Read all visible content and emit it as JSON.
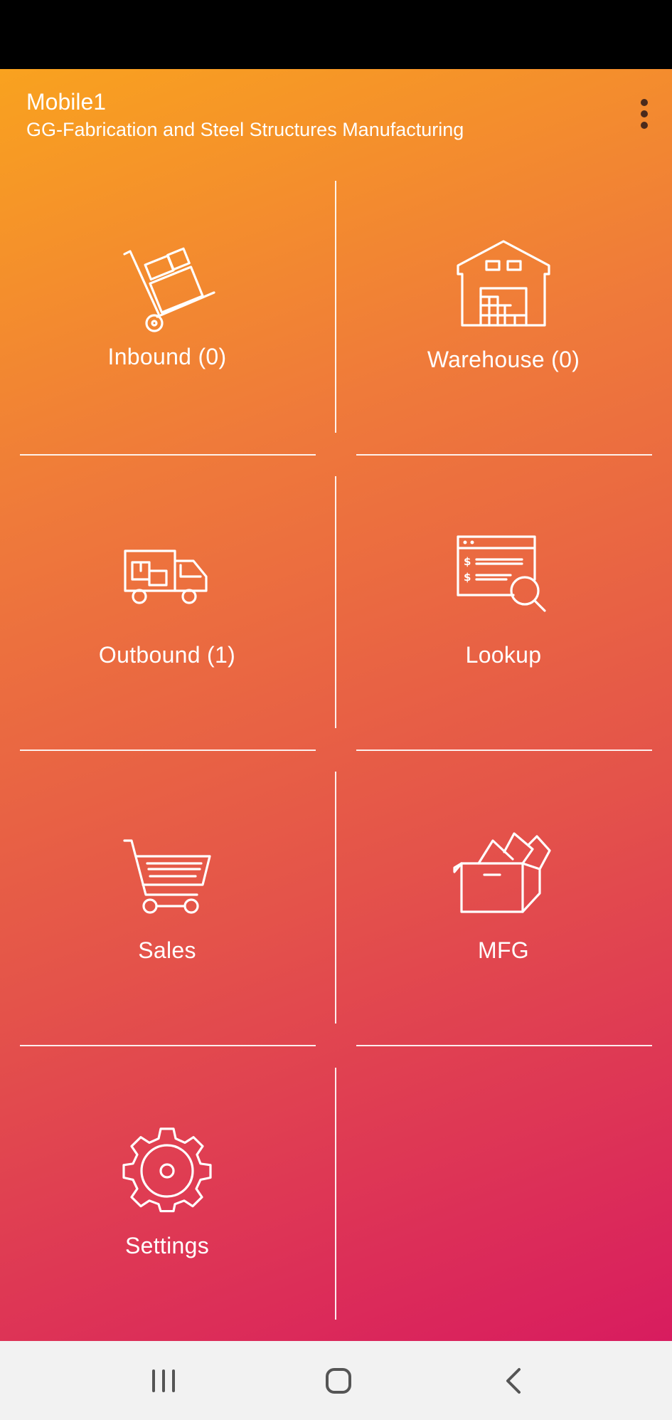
{
  "header": {
    "title": "Mobile1",
    "subtitle": "GG-Fabrication and Steel Structures Manufacturing"
  },
  "menu": {
    "icon": "more-vertical-icon"
  },
  "tiles": [
    {
      "label": "Inbound (0)",
      "icon": "hand-truck-icon"
    },
    {
      "label": "Warehouse (0)",
      "icon": "warehouse-icon"
    },
    {
      "label": "Outbound (1)",
      "icon": "delivery-truck-icon"
    },
    {
      "label": "Lookup",
      "icon": "price-lookup-icon"
    },
    {
      "label": "Sales",
      "icon": "shopping-cart-icon"
    },
    {
      "label": "MFG",
      "icon": "open-box-icon"
    },
    {
      "label": "Settings",
      "icon": "gear-icon"
    }
  ],
  "nav": {
    "recents": "recent-apps-icon",
    "home": "home-icon",
    "back": "back-icon"
  },
  "colors": {
    "gradient_start": "#f9a21f",
    "gradient_end": "#d81c5f",
    "status_bar": "#000000",
    "nav_bar": "#f2f2f2"
  }
}
